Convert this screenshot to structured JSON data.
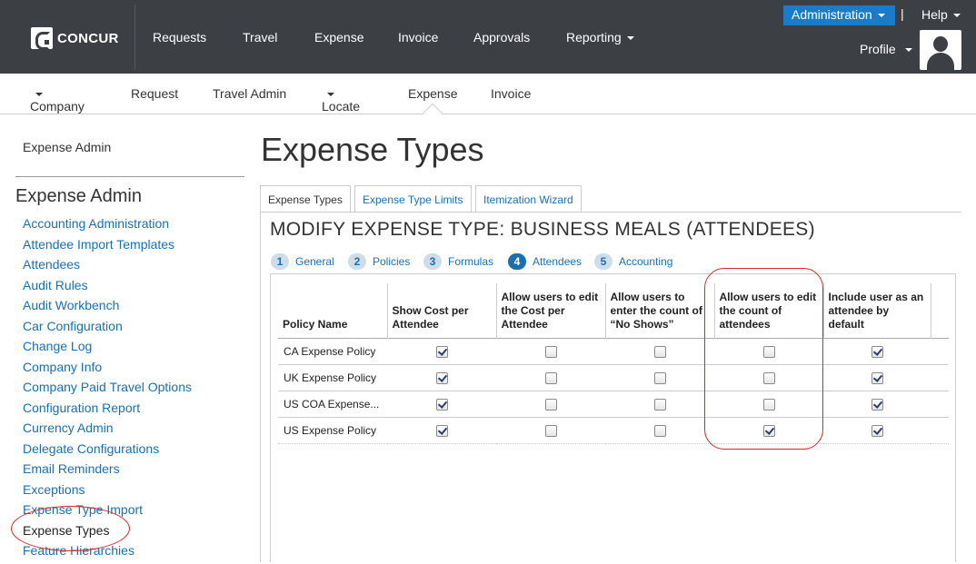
{
  "brand": {
    "logo_text": "CONCUR"
  },
  "top_nav": [
    "Requests",
    "Travel",
    "Expense",
    "Invoice",
    "Approvals",
    "Reporting"
  ],
  "top_right": {
    "administration": "Administration",
    "separator": "|",
    "help": "Help",
    "profile": "Profile"
  },
  "sub_nav": [
    "Company",
    "Request",
    "Travel Admin",
    "Locate",
    "Expense",
    "Invoice"
  ],
  "sidebar": {
    "top_link": "Expense Admin",
    "heading": "Expense Admin",
    "items": [
      "Accounting Administration",
      "Attendee Import Templates",
      "Attendees",
      "Audit Rules",
      "Audit Workbench",
      "Car Configuration",
      "Change Log",
      "Company Info",
      "Company Paid Travel Options",
      "Configuration Report",
      "Currency Admin",
      "Delegate Configurations",
      "Email Reminders",
      "Exceptions",
      "Expense Type Import",
      "Expense Types",
      "Feature Hierarchies"
    ],
    "active_item": "Expense Types"
  },
  "page_title": "Expense Types",
  "tabs": [
    "Expense Types",
    "Expense Type Limits",
    "Itemization Wizard"
  ],
  "active_tab": "Expense Types",
  "modify_title": "MODIFY EXPENSE TYPE: BUSINESS MEALS (ATTENDEES)",
  "steps": [
    {
      "num": "1",
      "label": "General"
    },
    {
      "num": "2",
      "label": "Policies"
    },
    {
      "num": "3",
      "label": "Formulas"
    },
    {
      "num": "4",
      "label": "Attendees"
    },
    {
      "num": "5",
      "label": "Accounting"
    }
  ],
  "active_step": "Attendees",
  "grid": {
    "columns": [
      "Policy Name",
      "Show Cost per Attendee",
      "Allow users to edit the Cost per Attendee",
      "Allow users to enter the count of “No Shows”",
      "Allow users to edit the count of attendees",
      "Include user as an attendee by default"
    ],
    "rows": [
      {
        "policy": "CA Expense Policy",
        "checks": [
          true,
          false,
          false,
          false,
          true
        ]
      },
      {
        "policy": "UK Expense Policy",
        "checks": [
          true,
          false,
          false,
          false,
          true
        ]
      },
      {
        "policy": "US COA Expense...",
        "checks": [
          true,
          false,
          false,
          false,
          true
        ]
      },
      {
        "policy": "US Expense Policy",
        "checks": [
          true,
          false,
          false,
          true,
          true
        ]
      }
    ]
  },
  "colors": {
    "topbar": "#3c3f44",
    "accent_blue": "#1a7cc9",
    "link": "#1a6fb0",
    "annotation_red": "#d9262c"
  }
}
